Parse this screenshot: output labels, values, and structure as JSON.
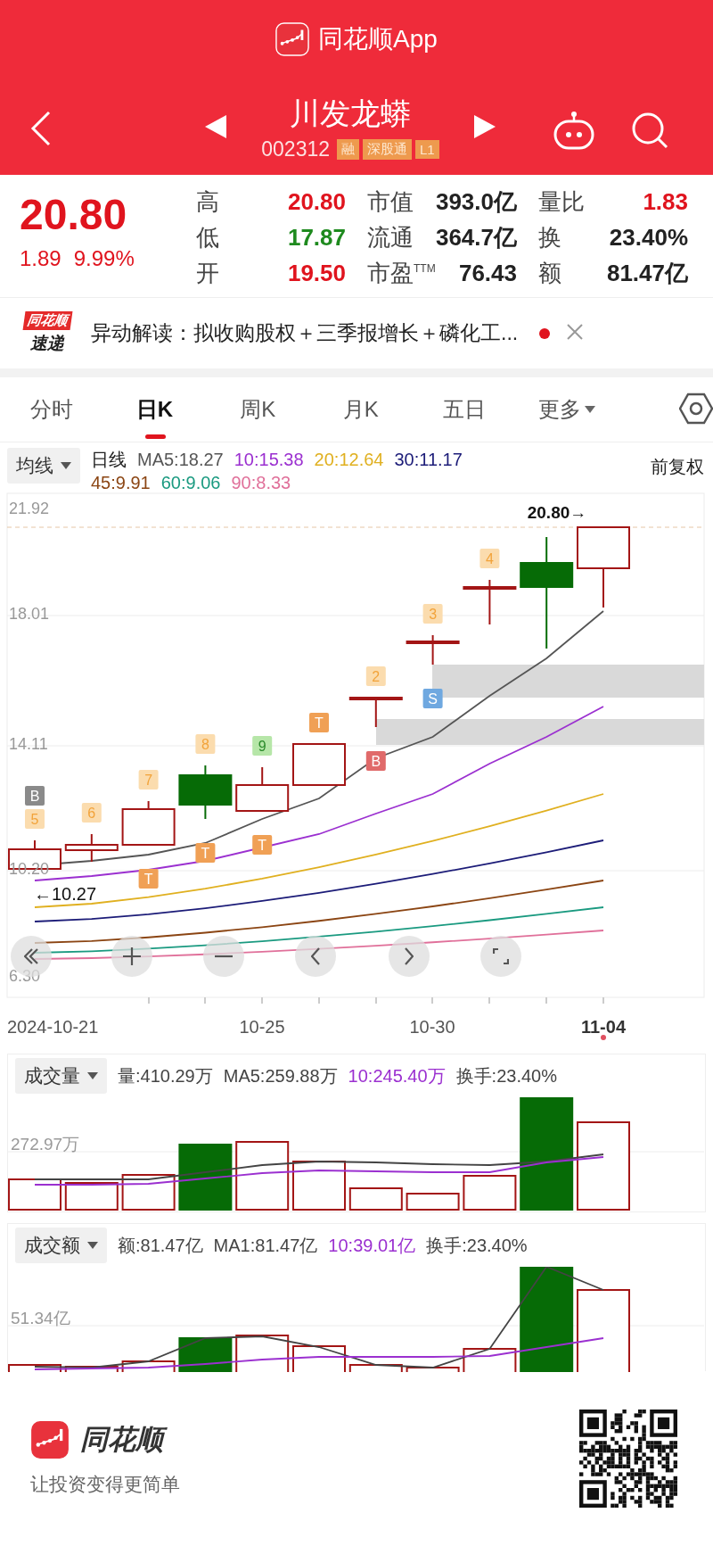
{
  "app_bar": {
    "title": "同花顺App"
  },
  "stock": {
    "name": "川发龙蟒",
    "code": "002312",
    "tags": [
      "融",
      "深股通",
      "L1"
    ]
  },
  "quote": {
    "price": "20.80",
    "change": "1.89",
    "change_percent": "9.99%",
    "stat_columns": [
      [
        {
          "label": "高",
          "value": "20.80",
          "color": "#e0141e"
        },
        {
          "label": "低",
          "value": "17.87",
          "color": "#1e8a1e"
        },
        {
          "label": "开",
          "value": "19.50",
          "color": "#e0141e"
        }
      ],
      [
        {
          "label": "市值",
          "value": "393.0亿",
          "color": "#222222"
        },
        {
          "label": "流通",
          "value": "364.7亿",
          "color": "#222222"
        },
        {
          "label": "市盈$^{TTM}$",
          "value": "76.43",
          "color": "#222222"
        }
      ],
      [
        {
          "label": "量比",
          "value": "1.83",
          "color": "#e0141e"
        },
        {
          "label": "换",
          "value": "23.40%",
          "color": "#222222"
        },
        {
          "label": "额",
          "value": "81.47亿",
          "color": "#222222"
        }
      ]
    ]
  },
  "news": {
    "source_top": "同花顺",
    "source_bottom": "速递",
    "text": "异动解读：拟收购股权＋三季报增长＋磷化工...",
    "unread": true
  },
  "tabs": [
    {
      "label": "分时",
      "selected": false,
      "kind": "plain"
    },
    {
      "label": "日K",
      "selected": true,
      "kind": "plain"
    },
    {
      "label": "周K",
      "selected": false,
      "kind": "plain"
    },
    {
      "label": "月K",
      "selected": false,
      "kind": "plain"
    },
    {
      "label": "五日",
      "selected": false,
      "kind": "plain"
    },
    {
      "label": "更多",
      "selected": false,
      "kind": "menu"
    }
  ],
  "legend": {
    "selector": "均线",
    "adjust": "前复权",
    "lines": [
      [
        {
          "text": "日线",
          "kind": "period",
          "color": "#222222"
        },
        {
          "text": "MA5:18.27",
          "kind": "ma",
          "color": "#555555"
        },
        {
          "text": "10:15.38",
          "kind": "ma",
          "color": "#9b30d0"
        },
        {
          "text": "20:12.64",
          "kind": "ma",
          "color": "#e0b020"
        },
        {
          "text": "30:11.17",
          "kind": "ma",
          "color": "#1c1c78"
        }
      ],
      [
        {
          "text": "45:9.91",
          "kind": "ma",
          "color": "#8b4513"
        },
        {
          "text": "60:9.06",
          "kind": "ma",
          "color": "#1a9a80"
        },
        {
          "text": "90:8.33",
          "kind": "ma",
          "color": "#e0709a"
        }
      ]
    ]
  },
  "k_chart": {
    "y_labels": [
      "21.92",
      "18.01",
      "14.11",
      "10.20",
      "6.30"
    ],
    "high_label": "20.80→",
    "low_label": "←10.27",
    "dates": [
      {
        "text": "2024-10-21",
        "current": false
      },
      {
        "text": "10-25",
        "current": false
      },
      {
        "text": "10-30",
        "current": false
      },
      {
        "text": "11-04",
        "current": true
      }
    ],
    "candles": [
      {
        "filled": false,
        "above": [
          {
            "text": "B",
            "kind": "buy_gray"
          },
          {
            "text": "5",
            "kind": "count"
          }
        ]
      },
      {
        "filled": false,
        "above": [
          {
            "text": "6",
            "kind": "count"
          }
        ]
      },
      {
        "filled": false,
        "above": [
          {
            "text": "7",
            "kind": "count"
          }
        ],
        "below": [
          {
            "text": "T",
            "kind": "trade_t"
          }
        ]
      },
      {
        "filled": true,
        "above": [
          {
            "text": "8",
            "kind": "count"
          }
        ],
        "below": [
          {
            "text": "T",
            "kind": "trade_t"
          }
        ]
      },
      {
        "filled": false,
        "above": [
          {
            "text": "9",
            "kind": "count_green"
          }
        ],
        "below": [
          {
            "text": "T",
            "kind": "trade_t"
          }
        ]
      },
      {
        "filled": false,
        "above": [
          {
            "text": "T",
            "kind": "trade_t"
          }
        ]
      },
      {
        "filled": false,
        "above": [
          {
            "text": "2",
            "kind": "count"
          }
        ],
        "below": [
          {
            "text": "B",
            "kind": "buy_red"
          }
        ]
      },
      {
        "filled": false,
        "above": [
          {
            "text": "3",
            "kind": "count"
          }
        ],
        "below": [
          {
            "text": "S",
            "kind": "sell"
          }
        ]
      },
      {
        "filled": false,
        "above": [
          {
            "text": "4",
            "kind": "count"
          }
        ]
      },
      {
        "filled": true
      },
      {
        "filled": false
      }
    ]
  },
  "volume_panel": {
    "selector": "成交量",
    "y_label": "272.97万",
    "items": [
      {
        "text": "量:410.29万",
        "kind": "value",
        "color": "#444444"
      },
      {
        "text": "MA5:259.88万",
        "kind": "ma",
        "color": "#444444"
      },
      {
        "text": "10:245.40万",
        "kind": "ma",
        "color": "#9b30d0"
      },
      {
        "text": "换手:23.40%",
        "kind": "value",
        "color": "#444444"
      }
    ]
  },
  "amount_panel": {
    "selector": "成交额",
    "y_label": "51.34亿",
    "items": [
      {
        "text": "额:81.47亿",
        "kind": "value",
        "color": "#444444"
      },
      {
        "text": "MA1:81.47亿",
        "kind": "ma",
        "color": "#444444"
      },
      {
        "text": "10:39.01亿",
        "kind": "ma",
        "color": "#9b30d0"
      },
      {
        "text": "换手:23.40%",
        "kind": "value",
        "color": "#444444"
      }
    ]
  },
  "footer": {
    "brand": "同花顺",
    "slogan": "让投资变得更简单"
  }
}
